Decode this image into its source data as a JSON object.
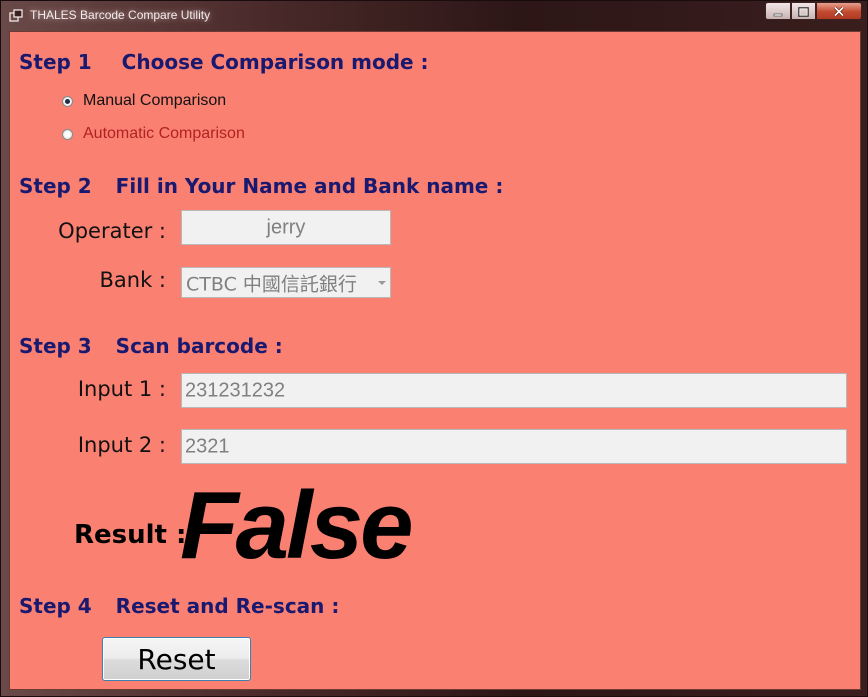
{
  "window": {
    "title": "THALES Barcode Compare Utility",
    "icon": "app-window-icon",
    "controls": [
      "minimize-icon",
      "maximize-icon",
      "close-icon"
    ]
  },
  "step1": {
    "num": "Step 1",
    "title": "Choose Comparison mode :",
    "options": [
      {
        "label": "Manual Comparison",
        "selected": true
      },
      {
        "label": "Automatic Comparison",
        "selected": false
      }
    ]
  },
  "step2": {
    "num": "Step 2",
    "title": "Fill in Your Name and Bank name :",
    "operator_label": "Operater :",
    "operator_value": "jerry",
    "bank_label": "Bank :",
    "bank_value": "CTBC  中國信託銀行"
  },
  "step3": {
    "num": "Step 3",
    "title": "Scan barcode :",
    "input1_label": "Input 1 :",
    "input1_value": "231231232",
    "input2_label": "Input 2 :",
    "input2_value": "2321"
  },
  "result": {
    "label": "Result :",
    "value": "False"
  },
  "step4": {
    "num": "Step 4",
    "title": "Reset and Re-scan :",
    "reset_label": "Reset"
  },
  "colors": {
    "background": "#fa8072",
    "step_heading": "#191970",
    "unselected_option": "#b22222"
  }
}
